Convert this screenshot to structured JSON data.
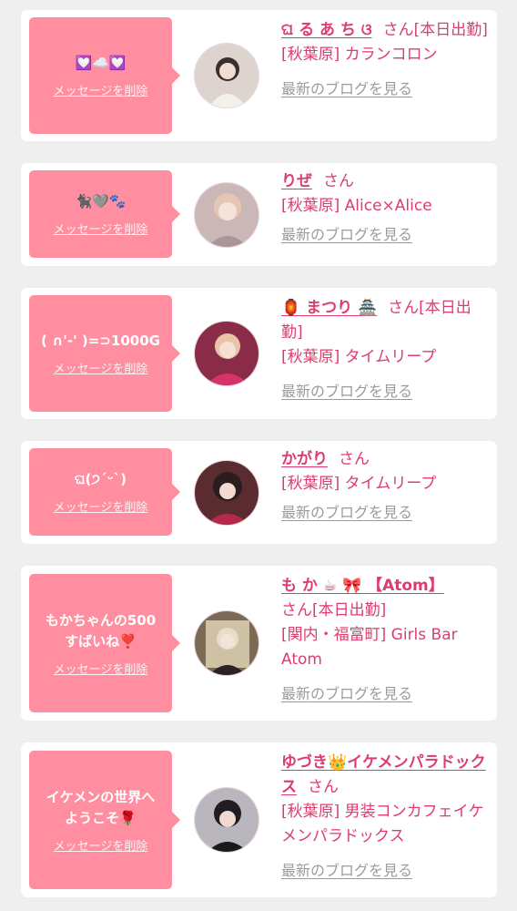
{
  "delete_label": "メッセージを削除",
  "blog_label": "最新のブログを見る",
  "san_label": "さん",
  "accent_color": "#dc3d6c",
  "bubble_color": "#ff8ea0",
  "entries": [
    {
      "message": "💟☁️💟",
      "name": "ଘ る あ ち ଓ",
      "status": "[本日出勤]",
      "shop": "[秋葉原] カランコロン"
    },
    {
      "message": "🐈‍⬛🩶🐾",
      "name": "りぜ",
      "status": "",
      "shop": "[秋葉原] Alice×Alice"
    },
    {
      "message": "( ∩'-' )=⊃1000G",
      "name": "🏮 まつり 🏯",
      "status": "[本日出勤]",
      "shop": "[秋葉原] タイムリープ"
    },
    {
      "message": "ଘ(੭ˊᵕˋ)",
      "name": "かがり",
      "status": "",
      "shop": "[秋葉原] タイムリープ"
    },
    {
      "message": "もかちゃんの500\nすばいね❣️",
      "name": "も か ☕ 🎀 【Atom】",
      "status": "[本日出勤]",
      "shop": "[関内・福富町] Girls Bar Atom"
    },
    {
      "message": "イケメンの世界へ\nようこそ🌹",
      "name": "ゆづき👑イケメンパラドックス",
      "status": "",
      "shop": "[秋葉原] 男装コンカフェイケメンパラドックス"
    }
  ]
}
